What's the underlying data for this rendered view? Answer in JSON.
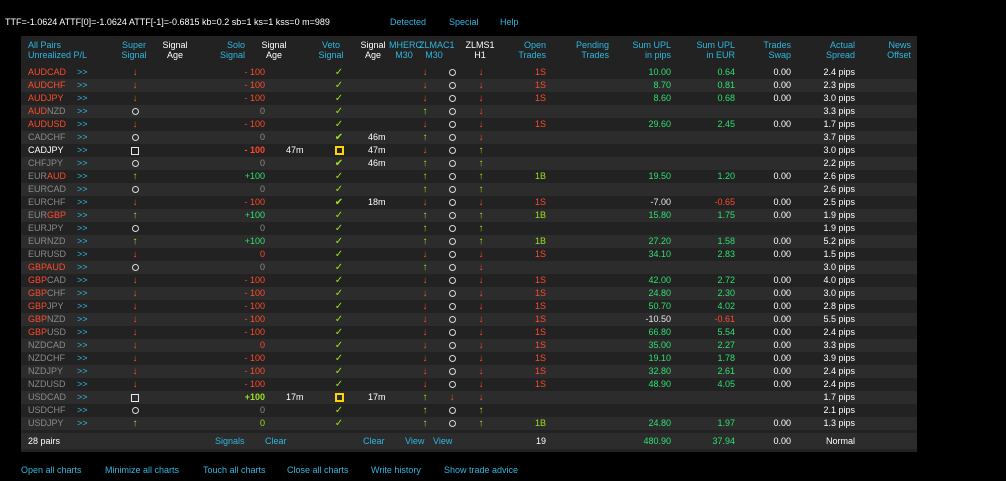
{
  "header": {
    "status_line": "TTF=-1.0624 ATTF[0]=-1.0624 ATTF[-1]=-0.6815 kb=0.2 sb=1 ks=1 kss=0 m=989",
    "menu": [
      "Detected",
      "Special",
      "Help"
    ]
  },
  "columns": {
    "pairs": "All Pairs",
    "unrealized": "Unrealized P/L",
    "super": [
      "Super",
      "Signal"
    ],
    "sig_age": [
      "Signal",
      "Age"
    ],
    "solo": [
      "Solo",
      "Signal"
    ],
    "solo_age": [
      "Signal",
      "Age"
    ],
    "veto": [
      "Veto",
      "Signal"
    ],
    "veto_age": [
      "Signal",
      "Age"
    ],
    "mherc": [
      "MHERC",
      "M30"
    ],
    "zlmac": [
      "ZLMAC1",
      "M30"
    ],
    "zlms": [
      "ZLMS1",
      "H1"
    ],
    "open": [
      "Open",
      "Trades"
    ],
    "pending": [
      "Pending",
      "Trades"
    ],
    "upl_pips": [
      "Sum UPL",
      "in pips"
    ],
    "upl_eur": [
      "Sum UPL",
      "in EUR"
    ],
    "swap": [
      "Trades",
      "Swap"
    ],
    "spread": [
      "Actual",
      "Spread"
    ],
    "news": [
      "News",
      "Offset"
    ]
  },
  "rows": [
    {
      "b": "AUD",
      "q": "CAD",
      "bc": "red",
      "qc": "red",
      "go": ">>",
      "s": "dn",
      "sig": "- 100",
      "sc": "red",
      "sage": "",
      "v": "ck",
      "vage": "",
      "m": "dn",
      "z": "o",
      "zl": "dn",
      "open": "1S",
      "pend": "",
      "pips": "10.00",
      "eur": "0.64",
      "swap": "0.00",
      "spr": "2.4 pips"
    },
    {
      "b": "AUD",
      "q": "CHF",
      "bc": "red",
      "qc": "red",
      "go": ">>",
      "s": "dn",
      "sig": "- 100",
      "sc": "red",
      "sage": "",
      "v": "ck",
      "vage": "",
      "m": "dn",
      "z": "o",
      "zl": "dn",
      "open": "1S",
      "pend": "",
      "pips": "8.70",
      "eur": "0.81",
      "swap": "0.00",
      "spr": "2.3 pips"
    },
    {
      "b": "AUD",
      "q": "JPY",
      "bc": "red",
      "qc": "red",
      "go": ">>",
      "s": "dn",
      "sig": "- 100",
      "sc": "red",
      "sage": "",
      "v": "ck",
      "vage": "",
      "m": "dn",
      "z": "o",
      "zl": "dn",
      "open": "1S",
      "pend": "",
      "pips": "8.60",
      "eur": "0.68",
      "swap": "0.00",
      "spr": "3.0 pips"
    },
    {
      "b": "AUD",
      "q": "NZD",
      "bc": "red",
      "qc": "grey",
      "go": ">>",
      "s": "o",
      "sig": "0",
      "sc": "grey",
      "sage": "",
      "v": "ck",
      "vage": "",
      "m": "up",
      "z": "o",
      "zl": "dn",
      "open": "",
      "pend": "",
      "pips": "",
      "eur": "",
      "swap": "",
      "spr": "3.3 pips"
    },
    {
      "b": "AUD",
      "q": "USD",
      "bc": "red",
      "qc": "red",
      "go": ">>",
      "s": "dn",
      "sig": "- 100",
      "sc": "red",
      "sage": "",
      "v": "ck",
      "vage": "",
      "m": "dn",
      "z": "o",
      "zl": "dn",
      "open": "1S",
      "pend": "",
      "pips": "29.60",
      "eur": "2.45",
      "swap": "0.00",
      "spr": "1.7 pips"
    },
    {
      "b": "CAD",
      "q": "CHF",
      "bc": "grey",
      "qc": "grey",
      "go": ">>",
      "s": "o",
      "sig": "0",
      "sc": "grey",
      "sage": "",
      "v": "ckb",
      "vage": "46m",
      "m": "up",
      "z": "o",
      "zl": "dn",
      "open": "",
      "pend": "",
      "pips": "",
      "eur": "",
      "swap": "",
      "spr": "3.7 pips"
    },
    {
      "b": "CAD",
      "q": "JPY",
      "bc": "white",
      "qc": "white",
      "go": ">>",
      "s": "sq",
      "sig": "- 100",
      "sc": "bred",
      "sage": "47m",
      "v": "sqy",
      "vage": "47m",
      "m": "dn",
      "z": "o",
      "zl": "up",
      "open": "",
      "pend": "",
      "pips": "",
      "eur": "",
      "swap": "",
      "spr": "3.0 pips"
    },
    {
      "b": "CHF",
      "q": "JPY",
      "bc": "grey",
      "qc": "grey",
      "go": ">>",
      "s": "o",
      "sig": "0",
      "sc": "grey",
      "sage": "",
      "v": "ckb",
      "vage": "46m",
      "m": "up",
      "z": "o",
      "zl": "up",
      "open": "",
      "pend": "",
      "pips": "",
      "eur": "",
      "swap": "",
      "spr": "2.2 pips"
    },
    {
      "b": "EUR",
      "q": "AUD",
      "bc": "grey",
      "qc": "red",
      "go": ">>",
      "s": "up",
      "sig": "+100",
      "sc": "green",
      "sage": "",
      "v": "ck",
      "vage": "",
      "m": "up",
      "z": "o",
      "zl": "up",
      "open": "1B",
      "pend": "",
      "pips": "19.50",
      "eur": "1.20",
      "swap": "0.00",
      "spr": "2.6 pips"
    },
    {
      "b": "EUR",
      "q": "CAD",
      "bc": "grey",
      "qc": "grey",
      "go": ">>",
      "s": "o",
      "sig": "0",
      "sc": "grey",
      "sage": "",
      "v": "ck",
      "vage": "",
      "m": "up",
      "z": "o",
      "zl": "up",
      "open": "",
      "pend": "",
      "pips": "",
      "eur": "",
      "swap": "",
      "spr": "2.6 pips"
    },
    {
      "b": "EUR",
      "q": "CHF",
      "bc": "grey",
      "qc": "grey",
      "go": ">>",
      "s": "dn",
      "sig": "- 100",
      "sc": "red",
      "sage": "",
      "v": "ckb",
      "vage": "18m",
      "m": "dn",
      "z": "o",
      "zl": "dn",
      "open": "1S",
      "pend": "",
      "pips": "-7.00",
      "eur": "-0.65",
      "swap": "0.00",
      "spr": "2.5 pips"
    },
    {
      "b": "EUR",
      "q": "GBP",
      "bc": "grey",
      "qc": "red",
      "go": ">>",
      "s": "up",
      "sig": "+100",
      "sc": "green",
      "sage": "",
      "v": "ck",
      "vage": "",
      "m": "up",
      "z": "o",
      "zl": "up",
      "open": "1B",
      "pend": "",
      "pips": "15.80",
      "eur": "1.75",
      "swap": "0.00",
      "spr": "1.9 pips"
    },
    {
      "b": "EUR",
      "q": "JPY",
      "bc": "grey",
      "qc": "grey",
      "go": ">>",
      "s": "o",
      "sig": "0",
      "sc": "grey",
      "sage": "",
      "v": "ck",
      "vage": "",
      "m": "up",
      "z": "o",
      "zl": "up",
      "open": "",
      "pend": "",
      "pips": "",
      "eur": "",
      "swap": "",
      "spr": "1.9 pips"
    },
    {
      "b": "EUR",
      "q": "NZD",
      "bc": "grey",
      "qc": "grey",
      "go": ">>",
      "s": "up",
      "sig": "+100",
      "sc": "green",
      "sage": "",
      "v": "ck",
      "vage": "",
      "m": "up",
      "z": "o",
      "zl": "up",
      "open": "1B",
      "pend": "",
      "pips": "27.20",
      "eur": "1.58",
      "swap": "0.00",
      "spr": "5.2 pips"
    },
    {
      "b": "EUR",
      "q": "USD",
      "bc": "grey",
      "qc": "grey",
      "go": ">>",
      "s": "dn",
      "sig": "0",
      "sc": "red",
      "sage": "",
      "v": "ck",
      "vage": "",
      "m": "dn",
      "z": "o",
      "zl": "dn",
      "open": "1S",
      "pend": "",
      "pips": "34.10",
      "eur": "2.83",
      "swap": "0.00",
      "spr": "1.5 pips"
    },
    {
      "b": "GBP",
      "q": "AUD",
      "bc": "red",
      "qc": "red",
      "go": ">>",
      "s": "o",
      "sig": "0",
      "sc": "grey",
      "sage": "",
      "v": "ck",
      "vage": "",
      "m": "up",
      "z": "o",
      "zl": "dn",
      "open": "",
      "pend": "",
      "pips": "",
      "eur": "",
      "swap": "",
      "spr": "3.0 pips"
    },
    {
      "b": "GBP",
      "q": "CAD",
      "bc": "red",
      "qc": "grey",
      "go": ">>",
      "s": "dn",
      "sig": "- 100",
      "sc": "red",
      "sage": "",
      "v": "ck",
      "vage": "",
      "m": "dn",
      "z": "o",
      "zl": "dn",
      "open": "1S",
      "pend": "",
      "pips": "42.00",
      "eur": "2.72",
      "swap": "0.00",
      "spr": "4.0 pips"
    },
    {
      "b": "GBP",
      "q": "CHF",
      "bc": "red",
      "qc": "grey",
      "go": ">>",
      "s": "dn",
      "sig": "- 100",
      "sc": "red",
      "sage": "",
      "v": "ck",
      "vage": "",
      "m": "dn",
      "z": "o",
      "zl": "dn",
      "open": "1S",
      "pend": "",
      "pips": "24.80",
      "eur": "2.30",
      "swap": "0.00",
      "spr": "3.0 pips"
    },
    {
      "b": "GBP",
      "q": "JPY",
      "bc": "red",
      "qc": "grey",
      "go": ">>",
      "s": "dn",
      "sig": "- 100",
      "sc": "red",
      "sage": "",
      "v": "ck",
      "vage": "",
      "m": "dn",
      "z": "o",
      "zl": "dn",
      "open": "1S",
      "pend": "",
      "pips": "50.70",
      "eur": "4.02",
      "swap": "0.00",
      "spr": "2.8 pips"
    },
    {
      "b": "GBP",
      "q": "NZD",
      "bc": "red",
      "qc": "grey",
      "go": ">>",
      "s": "dn",
      "sig": "- 100",
      "sc": "red",
      "sage": "",
      "v": "ck",
      "vage": "",
      "m": "dn",
      "z": "o",
      "zl": "dn",
      "open": "1S",
      "pend": "",
      "pips": "-10.50",
      "eur": "-0.61",
      "swap": "0.00",
      "spr": "5.5 pips"
    },
    {
      "b": "GBP",
      "q": "USD",
      "bc": "red",
      "qc": "grey",
      "go": ">>",
      "s": "dn",
      "sig": "- 100",
      "sc": "red",
      "sage": "",
      "v": "ck",
      "vage": "",
      "m": "dn",
      "z": "o",
      "zl": "dn",
      "open": "1S",
      "pend": "",
      "pips": "66.80",
      "eur": "5.54",
      "swap": "0.00",
      "spr": "2.4 pips"
    },
    {
      "b": "NZD",
      "q": "CAD",
      "bc": "grey",
      "qc": "grey",
      "go": ">>",
      "s": "dn",
      "sig": "0",
      "sc": "red",
      "sage": "",
      "v": "ck",
      "vage": "",
      "m": "dn",
      "z": "o",
      "zl": "dn",
      "open": "1S",
      "pend": "",
      "pips": "35.00",
      "eur": "2.27",
      "swap": "0.00",
      "spr": "3.3 pips"
    },
    {
      "b": "NZD",
      "q": "CHF",
      "bc": "grey",
      "qc": "grey",
      "go": ">>",
      "s": "dn",
      "sig": "- 100",
      "sc": "red",
      "sage": "",
      "v": "ck",
      "vage": "",
      "m": "dn",
      "z": "o",
      "zl": "dn",
      "open": "1S",
      "pend": "",
      "pips": "19.10",
      "eur": "1.78",
      "swap": "0.00",
      "spr": "3.9 pips"
    },
    {
      "b": "NZD",
      "q": "JPY",
      "bc": "grey",
      "qc": "grey",
      "go": ">>",
      "s": "dn",
      "sig": "- 100",
      "sc": "red",
      "sage": "",
      "v": "ck",
      "vage": "",
      "m": "dn",
      "z": "o",
      "zl": "dn",
      "open": "1S",
      "pend": "",
      "pips": "32.80",
      "eur": "2.61",
      "swap": "0.00",
      "spr": "2.4 pips"
    },
    {
      "b": "NZD",
      "q": "USD",
      "bc": "grey",
      "qc": "grey",
      "go": ">>",
      "s": "dn",
      "sig": "- 100",
      "sc": "red",
      "sage": "",
      "v": "ck",
      "vage": "",
      "m": "dn",
      "z": "o",
      "zl": "dn",
      "open": "1S",
      "pend": "",
      "pips": "48.90",
      "eur": "4.05",
      "swap": "0.00",
      "spr": "2.4 pips"
    },
    {
      "b": "USD",
      "q": "CAD",
      "bc": "grey",
      "qc": "grey",
      "go": ">>",
      "s": "sq",
      "sig": "+100",
      "sc": "bgreen",
      "sage": "17m",
      "v": "sqy",
      "vage": "17m",
      "m": "up",
      "z": "dn",
      "zl": "dn",
      "open": "",
      "pend": "",
      "pips": "",
      "eur": "",
      "swap": "",
      "spr": "1.7 pips"
    },
    {
      "b": "USD",
      "q": "CHF",
      "bc": "grey",
      "qc": "grey",
      "go": ">>",
      "s": "o",
      "sig": "0",
      "sc": "grey",
      "sage": "",
      "v": "ck",
      "vage": "",
      "m": "up",
      "z": "o",
      "zl": "up",
      "open": "",
      "pend": "",
      "pips": "",
      "eur": "",
      "swap": "",
      "spr": "2.1 pips"
    },
    {
      "b": "USD",
      "q": "JPY",
      "bc": "grey",
      "qc": "grey",
      "go": ">>",
      "s": "up",
      "sig": "0",
      "sc": "lgreen",
      "sage": "",
      "v": "ck",
      "vage": "",
      "m": "up",
      "z": "o",
      "zl": "up",
      "open": "1B",
      "pend": "",
      "pips": "24.80",
      "eur": "1.97",
      "swap": "0.00",
      "spr": "1.3 pips"
    }
  ],
  "footer": {
    "pairs": "28 pairs",
    "signals": "Signals",
    "clear1": "Clear",
    "clear2": "Clear",
    "view1": "View",
    "view2": "View",
    "open_total": "19",
    "pips_total": "480.90",
    "eur_total": "37.94",
    "swap_total": "0.00",
    "spread_total": "Normal"
  },
  "bottom_links": [
    "Open all charts",
    "Minimize all charts",
    "Touch all charts",
    "Close all charts",
    "Write history",
    "Show trade advice"
  ],
  "icons": {
    "dn": "arrow-down-icon",
    "up": "arrow-up-icon",
    "o": "circle-icon",
    "ck": "check-icon",
    "sq": "square-icon",
    "sqy": "yellow-square-icon"
  },
  "colors": {
    "accent": "#2fb7e0",
    "red": "#ff4b2b",
    "green": "#2fe070",
    "yellow": "#ffd400",
    "panel": "#222222"
  }
}
